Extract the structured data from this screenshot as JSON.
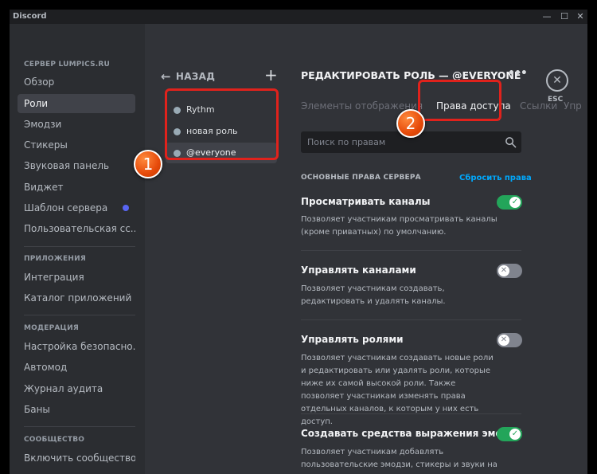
{
  "window": {
    "title": "Discord",
    "controls": {
      "minimize": "—",
      "maximize": "☐",
      "close": "✕"
    }
  },
  "sidebar": {
    "sections": [
      {
        "header": "СЕРВЕР LUMPICS.RU",
        "items": [
          {
            "label": "Обзор"
          },
          {
            "label": "Роли",
            "active": true
          },
          {
            "label": "Эмодзи"
          },
          {
            "label": "Стикеры"
          },
          {
            "label": "Звуковая панель"
          },
          {
            "label": "Виджет"
          },
          {
            "label": "Шаблон сервера",
            "badge": "blue-dot"
          },
          {
            "label": "Пользовательская сс..."
          }
        ]
      },
      {
        "header": "ПРИЛОЖЕНИЯ",
        "items": [
          {
            "label": "Интеграция"
          },
          {
            "label": "Каталог приложений"
          }
        ]
      },
      {
        "header": "МОДЕРАЦИЯ",
        "items": [
          {
            "label": "Настройка безопасно..."
          },
          {
            "label": "Автомод"
          },
          {
            "label": "Журнал аудита"
          },
          {
            "label": "Баны"
          }
        ]
      },
      {
        "header": "СООБЩЕСТВО",
        "items": [
          {
            "label": "Включить сообщество"
          }
        ]
      }
    ]
  },
  "roles_panel": {
    "back_label": "НАЗАД",
    "add_icon": "plus-icon",
    "roles": [
      {
        "name": "Rythm",
        "color": "#99aab5"
      },
      {
        "name": "новая роль",
        "color": "#99aab5"
      },
      {
        "name": "@everyone",
        "color": "#99aab5",
        "active": true
      }
    ]
  },
  "main": {
    "title": "РЕДАКТИРОВАТЬ РОЛЬ — @EVERYONE",
    "more_label": "•••",
    "esc_label": "ESC",
    "tabs": [
      {
        "label": "Элементы отображения"
      },
      {
        "label": "Права доступа",
        "active": true
      },
      {
        "label": "Ссылки"
      },
      {
        "label": "Упр"
      }
    ],
    "search": {
      "placeholder": "Поиск по правам",
      "value": ""
    },
    "group_header": "ОСНОВНЫЕ ПРАВА СЕРВЕРА",
    "reset_label": "Сбросить права",
    "permissions": [
      {
        "title": "Просматривать каналы",
        "description": "Позволяет участникам просматривать каналы (кроме приватных) по умолчанию.",
        "enabled": true
      },
      {
        "title": "Управлять каналами",
        "description": "Позволяет участникам создавать, редактировать и удалять каналы.",
        "enabled": false
      },
      {
        "title": "Управлять ролями",
        "description": "Позволяет участникам создавать новые роли и редактировать или удалять роли, которые ниже их самой высокой роли. Также позволяет участникам изменять права отдельных каналов, к которым у них есть доступ.",
        "enabled": false
      },
      {
        "title": "Создавать средства выражения эмоций",
        "description": "Позволяет участникам добавлять пользовательские эмодзи, стикеры и звуки на этом сервере.",
        "enabled": true
      }
    ]
  },
  "annotations": [
    {
      "number": "1",
      "color": "#e0221c"
    },
    {
      "number": "2",
      "color": "#e0221c"
    }
  ],
  "colors": {
    "background": "#313338",
    "sidebar": "#2b2d31",
    "accent_blue": "#5865f2",
    "link": "#00a8fc",
    "toggle_on": "#23a55a",
    "toggle_off": "#80848e",
    "highlight": "#e0221c"
  }
}
